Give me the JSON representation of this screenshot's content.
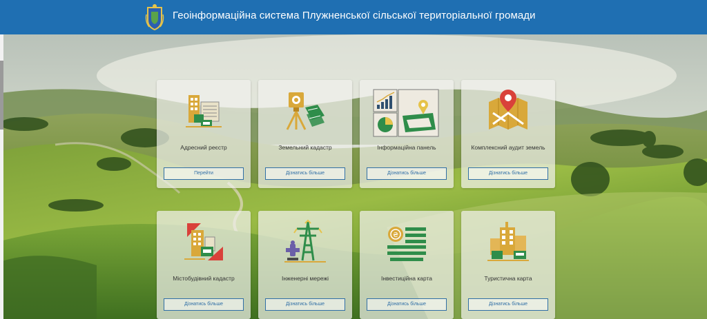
{
  "header": {
    "title": "Геоінформаційна система Плужненської сільської територіальної громади"
  },
  "cards": [
    {
      "title": "Адресний реєстр",
      "button": "Перейти",
      "icon": "buildings-address-icon"
    },
    {
      "title": "Земельний кадастр",
      "button": "Дізнатись більше",
      "icon": "theodolite-land-icon"
    },
    {
      "title": "Інформаційна панель",
      "button": "Дізнатись більше",
      "icon": "dashboard-icon"
    },
    {
      "title": "Комплексний аудит земель",
      "button": "Дізнатись більше",
      "icon": "map-pin-audit-icon"
    },
    {
      "title": "Містобудівний кадастр",
      "button": "Дізнатись більше",
      "icon": "urban-planning-icon"
    },
    {
      "title": "Інженерні мережі",
      "button": "Дізнатись більше",
      "icon": "power-tower-icon"
    },
    {
      "title": "Інвестиційна карта",
      "button": "Дізнатись більше",
      "icon": "investment-coin-icon"
    },
    {
      "title": "Туристична карта",
      "button": "Дізнатись більше",
      "icon": "tourist-buildings-icon"
    }
  ],
  "colors": {
    "header": "#1f6fb2",
    "accent_gold": "#d9a83a",
    "accent_green": "#2f8d4a",
    "accent_red": "#d9413a",
    "button_border": "#2f6ea5"
  }
}
